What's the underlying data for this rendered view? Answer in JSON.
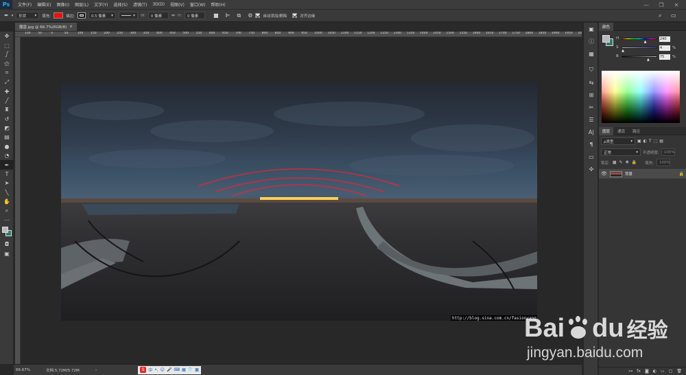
{
  "app": {
    "logo": "Ps",
    "menus": [
      "文件(F)",
      "编辑(E)",
      "图像(I)",
      "图层(L)",
      "文字(Y)",
      "选择(S)",
      "滤镜(T)",
      "3D(D)",
      "视图(V)",
      "窗口(W)",
      "帮助(H)"
    ]
  },
  "window_controls": {
    "minimize": "—",
    "restore": "❐",
    "close": "✕"
  },
  "options": {
    "mode": "形状",
    "fill_label": "填充:",
    "fill_color": "#e8120c",
    "stroke_label": "描边:",
    "stroke_width": "0.5 像素",
    "w_label": "W:",
    "w_value": "0 像素",
    "link": "⇔",
    "h_label": "H:",
    "h_value": "0 像素",
    "auto_add_delete": "自动添加/删除",
    "align_edges": "对齐边缘"
  },
  "document": {
    "tab": "魔兽.jpg @ 66.7%(RGB/8)",
    "close": "×"
  },
  "ruler_ticks": [
    "100",
    "50",
    "0",
    "50",
    "100",
    "150",
    "200",
    "250",
    "300",
    "350",
    "400",
    "450",
    "500",
    "550",
    "600",
    "650",
    "700",
    "750",
    "800",
    "850",
    "900",
    "950",
    "1000",
    "1050",
    "1100",
    "1150",
    "1200",
    "1250",
    "1300",
    "1350",
    "1400",
    "1450",
    "1500",
    "1550",
    "1600",
    "1650",
    "1700",
    "1750",
    "1800",
    "1850",
    "1900",
    "1950",
    "2000"
  ],
  "watermark_url": "http://blog.sina.com.cn/fasionyang",
  "status": {
    "zoom": "66.67%",
    "doc": "文档:5.72M/5.72M",
    "arrow": "›"
  },
  "ime": {
    "logo": "S",
    "lang": "中"
  },
  "color_panel": {
    "tab": "颜色",
    "h_label": "H",
    "h_value": "240",
    "s_label": "S",
    "s_value": "4",
    "s_unit": "%",
    "b_label": "B",
    "b_value": "75",
    "b_unit": "%",
    "s_fraction": 0.04,
    "b_fraction": 0.75,
    "h_fraction": 0.667,
    "fg": "#b9b9bf",
    "bg": "#2e7d6b"
  },
  "layers_panel": {
    "tabs": [
      "图层",
      "通道",
      "路径"
    ],
    "filter": "ρ类型",
    "blend_mode": "正常",
    "opacity_label": "不透明度:",
    "opacity_value": "100%",
    "lock_label": "锁定:",
    "fill_label": "填充:",
    "fill_value": "100%",
    "layer_name": "背景"
  },
  "baidu": {
    "brand": "Bai",
    "brand2": "du",
    "suffix": "经验",
    "domain": "jingyan.baidu.com"
  }
}
